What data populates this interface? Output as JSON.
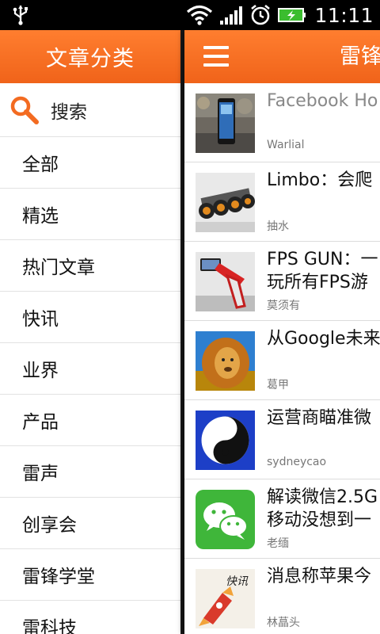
{
  "status_bar": {
    "time": "11:11"
  },
  "drawer": {
    "title": "文章分类",
    "search_label": "搜索",
    "categories": [
      "全部",
      "精选",
      "热门文章",
      "快讯",
      "业界",
      "产品",
      "雷声",
      "创享会",
      "雷锋学堂",
      "雷科技"
    ]
  },
  "main": {
    "title": "雷锋",
    "articles": [
      {
        "title_line1": "Facebook Ho",
        "title_line2": "",
        "author": "Warlial",
        "thumb_icon": "phone-photo-thumb"
      },
      {
        "title_line1": "Limbo：会爬",
        "title_line2": "",
        "author": "抽水",
        "thumb_icon": "robot-wheels-thumb"
      },
      {
        "title_line1": "FPS GUN：一",
        "title_line2": "玩所有FPS游",
        "author": "莫须有",
        "thumb_icon": "gun-controller-thumb"
      },
      {
        "title_line1": "从Google未来",
        "title_line2": "",
        "author": "葛甲",
        "thumb_icon": "lion-thumb"
      },
      {
        "title_line1": "运营商瞄准微",
        "title_line2": "",
        "author": "sydneycao",
        "thumb_icon": "yin-yang-thumb"
      },
      {
        "title_line1": "解读微信2.5G",
        "title_line2": "移动没想到一",
        "author": "老缅",
        "thumb_icon": "wechat-thumb"
      },
      {
        "title_line1": "消息称苹果今",
        "title_line2": "",
        "author": "林蕌头",
        "thumb_icon": "news-rocket-thumb",
        "thumb_text": "快讯"
      }
    ]
  },
  "colors": {
    "accent": "#f36b21",
    "text": "#111111",
    "muted": "#777777"
  }
}
